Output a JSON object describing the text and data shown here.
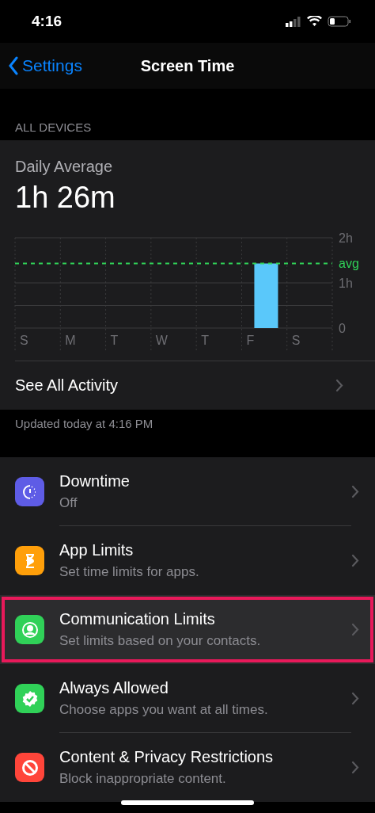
{
  "status_bar": {
    "time": "4:16"
  },
  "nav": {
    "back": "Settings",
    "title": "Screen Time"
  },
  "section_header": "ALL DEVICES",
  "summary": {
    "label": "Daily Average",
    "value": "1h 26m",
    "chart_data": {
      "type": "bar",
      "categories": [
        "S",
        "M",
        "T",
        "W",
        "T",
        "F",
        "S"
      ],
      "series": [
        {
          "color": "#5ac8fa",
          "values": [
            0,
            0,
            0,
            0,
            0,
            1.43,
            0
          ]
        }
      ],
      "ylim": [
        0,
        2
      ],
      "yticks": [
        {
          "value": 0,
          "label": "0"
        },
        {
          "value": 1,
          "label": "1h"
        },
        {
          "value": 2,
          "label": "2h"
        }
      ],
      "ref_lines": [
        {
          "axis": "y",
          "value": 1.43,
          "label": "avg",
          "color": "#30d158"
        }
      ]
    },
    "link": "See All Activity"
  },
  "updated": "Updated today at 4:16 PM",
  "items": [
    {
      "kind": "downtime",
      "title": "Downtime",
      "subtitle": "Off",
      "color": "#5e5ce6",
      "highlighted": false
    },
    {
      "kind": "hourglass",
      "title": "App Limits",
      "subtitle": "Set time limits for apps.",
      "color": "#ff9f0a",
      "highlighted": false
    },
    {
      "kind": "contact",
      "title": "Communication Limits",
      "subtitle": "Set limits based on your contacts.",
      "color": "#30d158",
      "highlighted": true
    },
    {
      "kind": "check",
      "title": "Always Allowed",
      "subtitle": "Choose apps you want at all times.",
      "color": "#30d158",
      "highlighted": false
    },
    {
      "kind": "block",
      "title": "Content & Privacy Restrictions",
      "subtitle": "Block inappropriate content.",
      "color": "#ff453a",
      "highlighted": false
    }
  ]
}
